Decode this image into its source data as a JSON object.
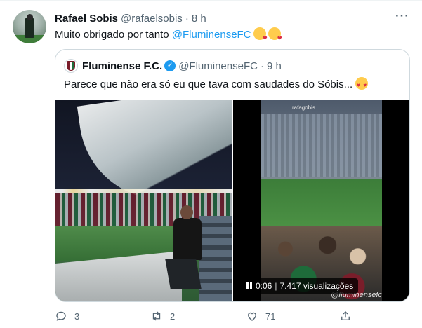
{
  "tweet": {
    "author_name": "Rafael Sobis",
    "author_handle": "@rafaelsobis",
    "separator": "·",
    "time": "8 h",
    "text_before": "Muito obrigado por tanto ",
    "mention": "@FluminenseFC",
    "emojis": [
      "kiss-heart-emoji",
      "kiss-heart-emoji"
    ]
  },
  "quote": {
    "author_name": "Fluminense F.C.",
    "verified": true,
    "author_handle": "@FluminenseFC",
    "separator": "·",
    "time": "9 h",
    "text": "Parece que não era só eu que tava com saudades do Sóbis...",
    "emoji": "heart-eyes-emoji",
    "video": {
      "overlay_user": "rafagobis",
      "watermark": "@fluminensefc",
      "elapsed": "0:06",
      "divider": "|",
      "views": "7.417 visualizações"
    }
  },
  "actions": {
    "replies": "3",
    "retweets": "2",
    "likes": "71"
  },
  "colors": {
    "accent": "#1d9bf0",
    "muted": "#536471",
    "text": "#0f1419",
    "border": "#cfd9de"
  },
  "icons": [
    "more-icon",
    "verified-icon",
    "reply-icon",
    "retweet-icon",
    "like-icon",
    "share-icon",
    "pause-icon"
  ]
}
